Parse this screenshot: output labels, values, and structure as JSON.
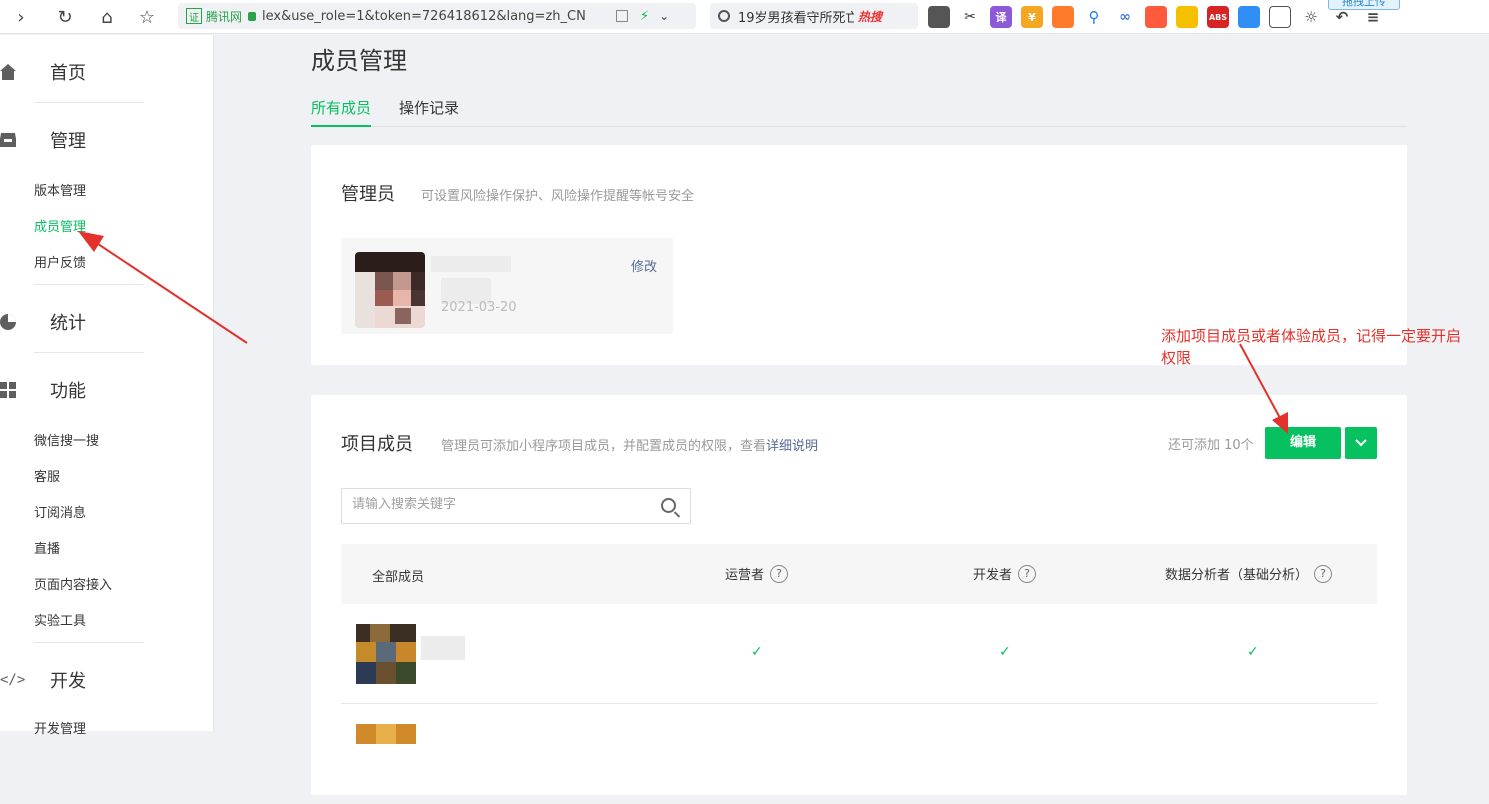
{
  "browser": {
    "url_site": "腾讯网",
    "url_badge": "证",
    "url_text": "lex&use_role=1&token=726418612&lang=zh_CN",
    "search_query": "19岁男孩看守所死亡",
    "search_hot": "热搜",
    "upload_label": "拖拽上传"
  },
  "sidebar": {
    "home": "首页",
    "manage": "管理",
    "manage_items": [
      "版本管理",
      "成员管理",
      "用户反馈"
    ],
    "stats": "统计",
    "features": "功能",
    "feature_items": [
      "微信搜一搜",
      "客服",
      "订阅消息",
      "直播",
      "页面内容接入",
      "实验工具"
    ],
    "dev": "开发",
    "dev_items": [
      "开发管理"
    ]
  },
  "main": {
    "title": "成员管理",
    "tabs": [
      "所有成员",
      "操作记录"
    ],
    "admin": {
      "title": "管理员",
      "desc": "可设置风险操作保护、风险操作提醒等帐号安全",
      "edit": "修改",
      "date": "2021-03-20"
    },
    "members": {
      "title": "项目成员",
      "desc": "管理员可添加小程序项目成员，并配置成员的权限，查看",
      "desc_link": "详细说明",
      "remain": "还可添加 10个",
      "edit_button": "编辑",
      "search_placeholder": "请输入搜索关键字",
      "columns": [
        "全部成员",
        "运营者",
        "开发者",
        "数据分析者（基础分析）"
      ],
      "help_glyph": "?",
      "check_glyph": "✓"
    }
  },
  "annotation": {
    "text_line1": "添加项目成员或者体验成员，记得一定要开启",
    "text_line2": "权限"
  },
  "colors": {
    "accent": "#07c160",
    "link": "#576b95",
    "annotation": "#e3322b"
  }
}
